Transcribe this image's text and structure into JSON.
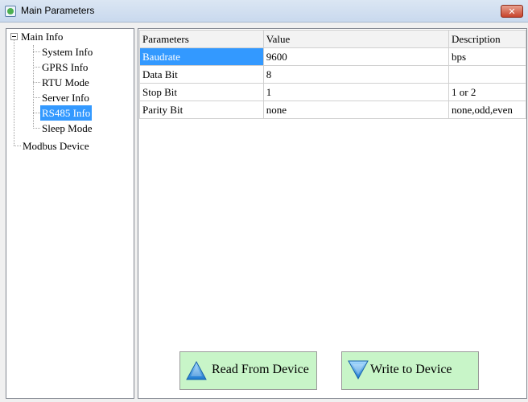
{
  "window": {
    "title": "Main Parameters",
    "close_glyph": "✕"
  },
  "tree": {
    "root": "Main Info",
    "children": [
      "System Info",
      "GPRS Info",
      "RTU Mode",
      "Server Info",
      "RS485 Info",
      "Sleep Mode"
    ],
    "selected": "RS485 Info",
    "sibling": "Modbus Device"
  },
  "grid": {
    "headers": [
      "Parameters",
      "Value",
      "Description"
    ],
    "rows": [
      {
        "param": "Baudrate",
        "value": "9600",
        "desc": "bps"
      },
      {
        "param": "Data Bit",
        "value": "8",
        "desc": ""
      },
      {
        "param": "Stop Bit",
        "value": "1",
        "desc": "1 or 2"
      },
      {
        "param": "Parity Bit",
        "value": "none",
        "desc": "none,odd,even"
      }
    ]
  },
  "buttons": {
    "read_label": "Read From Device",
    "write_label": "Write to Device"
  },
  "colors": {
    "selection": "#3399ff",
    "button_bg": "#c8f5c8"
  },
  "icons": {
    "read": "arrow-up-icon",
    "write": "arrow-down-icon",
    "app": "app-icon",
    "close": "close-icon"
  }
}
